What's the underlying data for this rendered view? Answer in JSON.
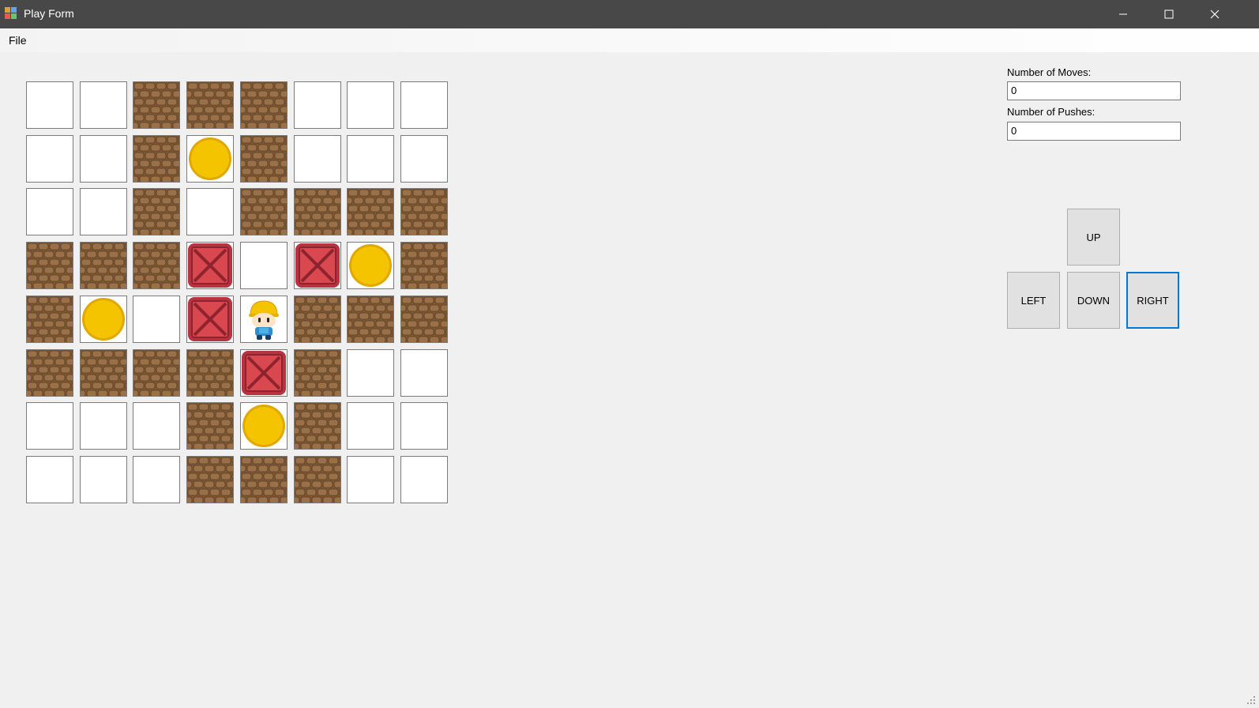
{
  "window": {
    "title": "Play Form",
    "controls": [
      "minimize",
      "maximize",
      "close"
    ]
  },
  "menu": {
    "items": [
      "File"
    ]
  },
  "board": {
    "rows": 8,
    "cols": 8,
    "legend": {
      "E": "empty",
      "W": "brick-wall",
      "G": "gold-target",
      "B": "crate",
      "P": "player"
    },
    "grid": [
      [
        "E",
        "E",
        "W",
        "W",
        "W",
        "E",
        "E",
        "E"
      ],
      [
        "E",
        "E",
        "W",
        "G",
        "W",
        "E",
        "E",
        "E"
      ],
      [
        "E",
        "E",
        "W",
        "E",
        "W",
        "W",
        "W",
        "W"
      ],
      [
        "W",
        "W",
        "W",
        "B",
        "E",
        "B",
        "G",
        "W"
      ],
      [
        "W",
        "G",
        "E",
        "B",
        "P",
        "W",
        "W",
        "W"
      ],
      [
        "W",
        "W",
        "W",
        "W",
        "B",
        "W",
        "E",
        "E"
      ],
      [
        "E",
        "E",
        "E",
        "W",
        "G",
        "W",
        "E",
        "E"
      ],
      [
        "E",
        "E",
        "E",
        "W",
        "W",
        "W",
        "E",
        "E"
      ]
    ]
  },
  "stats": {
    "moves_label": "Number of Moves:",
    "moves_value": "0",
    "pushes_label": "Number of Pushes:",
    "pushes_value": "0"
  },
  "controls": {
    "up": "UP",
    "left": "LEFT",
    "down": "DOWN",
    "right": "RIGHT",
    "focused": "right"
  },
  "colors": {
    "titlebar": "#484848",
    "brick": "#9a7048",
    "gold": "#f5c400",
    "crate": "#d9474f",
    "focus": "#0078d7"
  }
}
